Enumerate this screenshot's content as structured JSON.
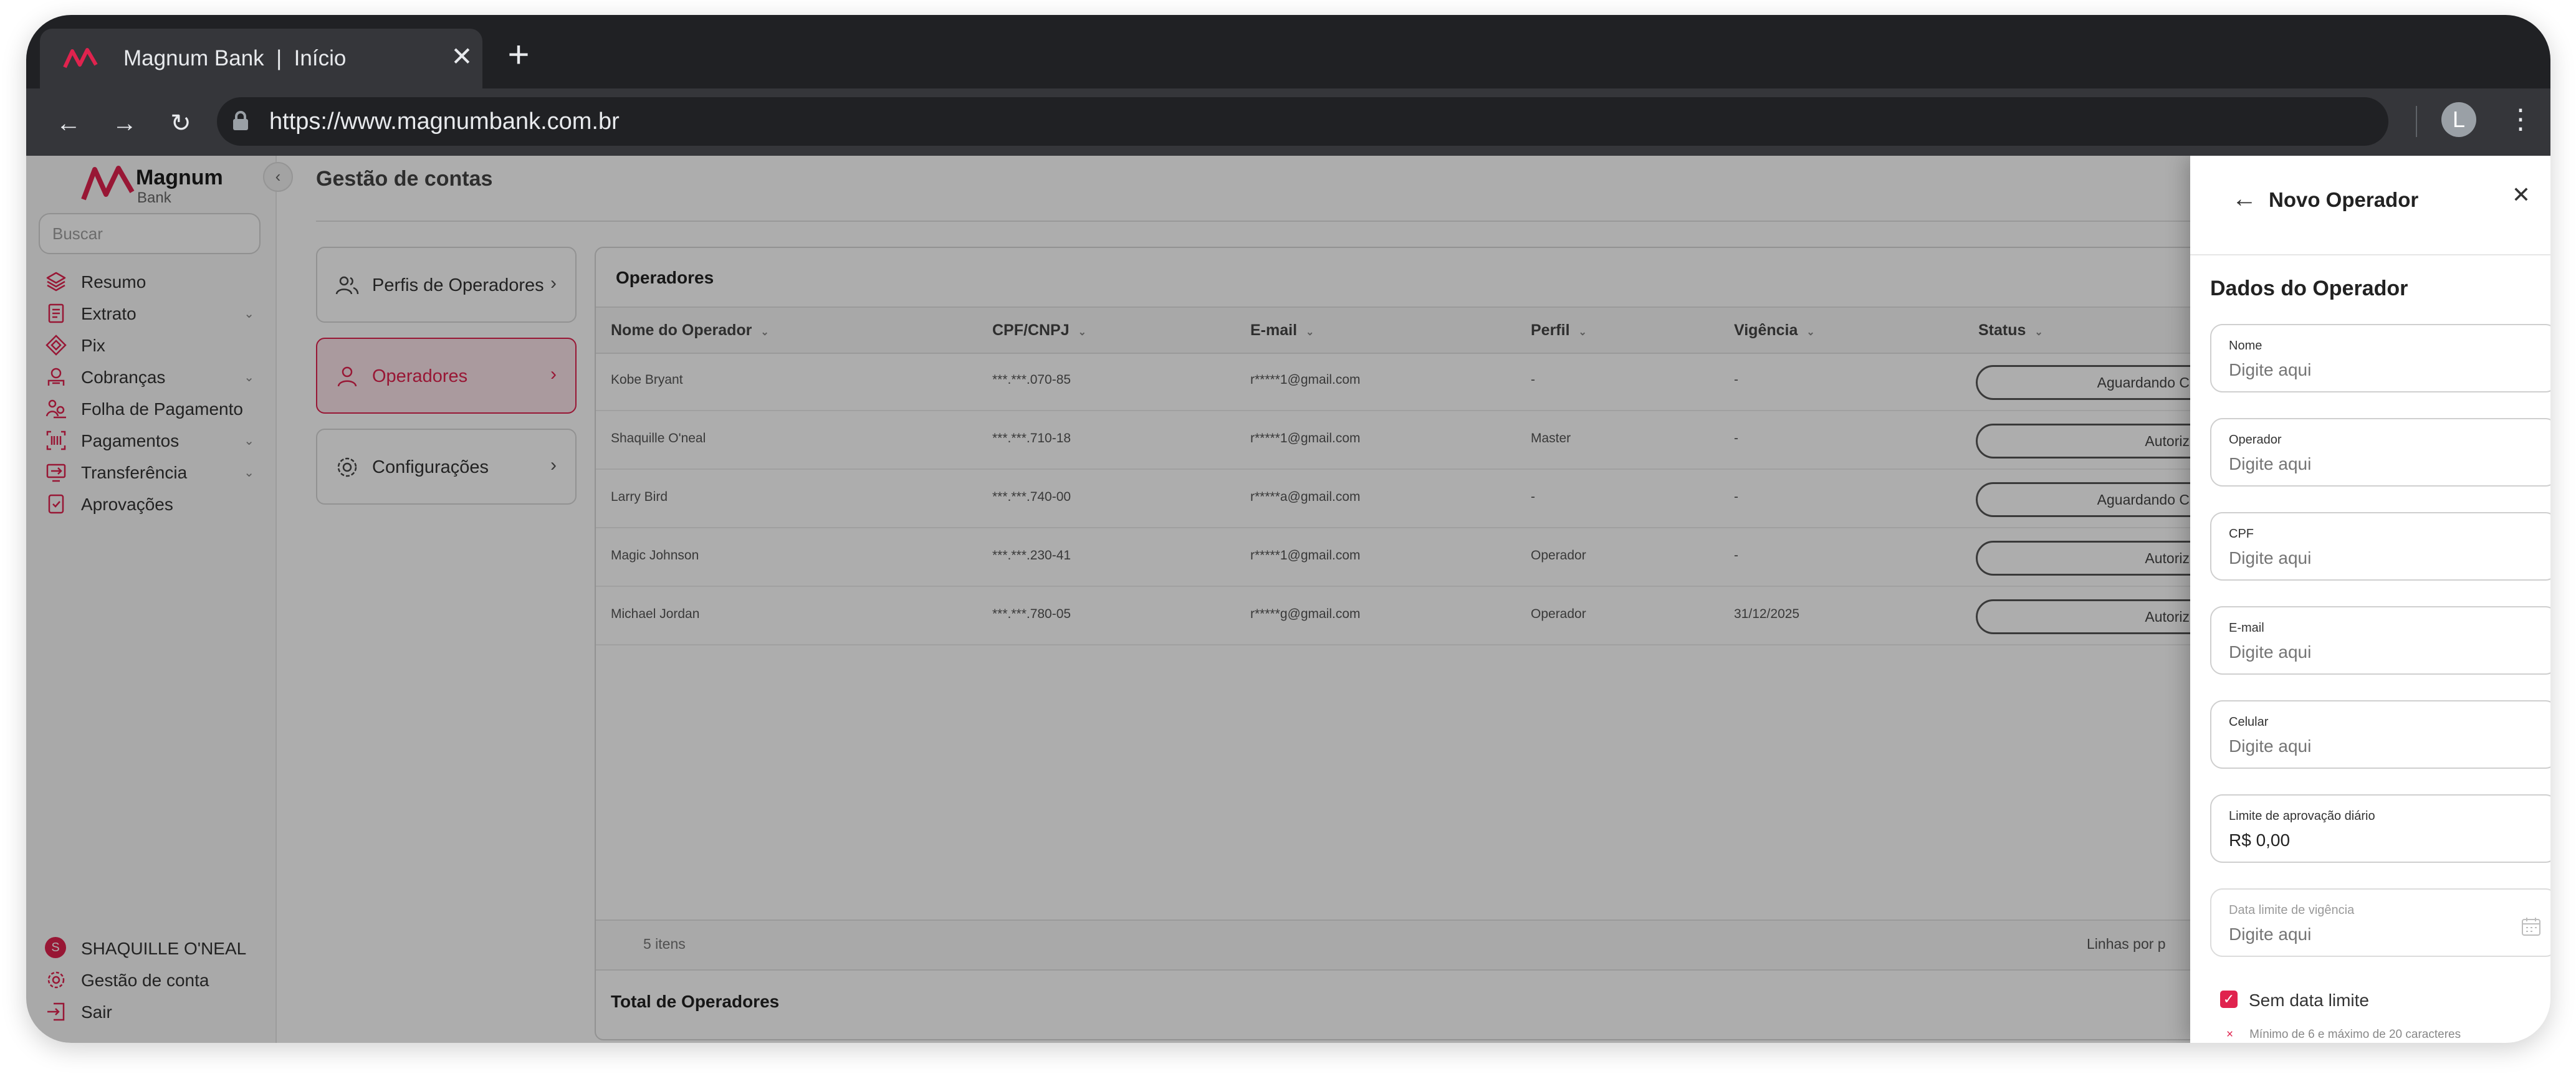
{
  "browser": {
    "tab_title": "Magnum Bank  |  Início",
    "url": "https://www.magnumbank.com.br",
    "profile_initial": "L"
  },
  "brand": {
    "name": "Magnum",
    "sub": "Bank",
    "color": "#e0234e"
  },
  "sidebar": {
    "search_placeholder": "Buscar",
    "items": [
      {
        "label": "Resumo",
        "icon": "layers-icon",
        "has_submenu": false
      },
      {
        "label": "Extrato",
        "icon": "statement-icon",
        "has_submenu": true
      },
      {
        "label": "Pix",
        "icon": "pix-icon",
        "has_submenu": false
      },
      {
        "label": "Cobranças",
        "icon": "billing-icon",
        "has_submenu": true
      },
      {
        "label": "Folha de Pagamento",
        "icon": "payroll-icon",
        "has_submenu": false
      },
      {
        "label": "Pagamentos",
        "icon": "barcode-icon",
        "has_submenu": true
      },
      {
        "label": "Transferência",
        "icon": "transfer-icon",
        "has_submenu": true
      },
      {
        "label": "Aprovações",
        "icon": "approval-icon",
        "has_submenu": false
      }
    ],
    "footer": {
      "user_initial": "S",
      "user_name": "SHAQUILLE O'NEAL",
      "account": "Gestão de conta",
      "logout": "Sair"
    }
  },
  "main": {
    "title": "Gestão de contas",
    "nav_cards": [
      {
        "label": "Perfis de Operadores",
        "icon": "users-icon",
        "active": false
      },
      {
        "label": "Operadores",
        "icon": "user-icon",
        "active": true
      },
      {
        "label": "Configurações",
        "icon": "gear-icon",
        "active": false
      }
    ]
  },
  "table": {
    "title": "Operadores",
    "columns": [
      "Nome do Operador",
      "CPF/CNPJ",
      "E-mail",
      "Perfil",
      "Vigência",
      "Status"
    ],
    "rows": [
      {
        "name": "Kobe Bryant",
        "doc": "***.***.070-85",
        "email": "r*****1@gmail.com",
        "profile": "-",
        "validity": "-",
        "status": "Aguardando C"
      },
      {
        "name": "Shaquille O'neal",
        "doc": "***.***.710-18",
        "email": "r*****1@gmail.com",
        "profile": "Master",
        "validity": "-",
        "status": "Autoriz"
      },
      {
        "name": "Larry Bird",
        "doc": "***.***.740-00",
        "email": "r*****a@gmail.com",
        "profile": "-",
        "validity": "-",
        "status": "Aguardando C"
      },
      {
        "name": "Magic Johnson",
        "doc": "***.***.230-41",
        "email": "r*****1@gmail.com",
        "profile": "Operador",
        "validity": "-",
        "status": "Autoriz"
      },
      {
        "name": "Michael Jordan",
        "doc": "***.***.780-05",
        "email": "r*****g@gmail.com",
        "profile": "Operador",
        "validity": "31/12/2025",
        "status": "Autoriz"
      }
    ],
    "footer_count": "5 itens",
    "footer_per_page": "Linhas por p",
    "total_label": "Total de Operadores"
  },
  "drawer": {
    "title": "Novo Operador",
    "section_title": "Dados do Operador",
    "fields": [
      {
        "label": "Nome",
        "value": "",
        "placeholder": "Digite aqui"
      },
      {
        "label": "Operador",
        "value": "",
        "placeholder": "Digite aqui"
      },
      {
        "label": "CPF",
        "value": "",
        "placeholder": "Digite aqui"
      },
      {
        "label": "E-mail",
        "value": "",
        "placeholder": "Digite aqui"
      },
      {
        "label": "Celular",
        "value": "",
        "placeholder": "Digite aqui"
      },
      {
        "label": "Limite de aprovação diário",
        "value": "R$ 0,00",
        "placeholder": ""
      },
      {
        "label": "Data limite de vigência",
        "value": "",
        "placeholder": "Digite aqui"
      }
    ],
    "checkbox_label": "Sem data limite",
    "checkbox_checked": true,
    "hint": "Mínimo de 6 e máximo de 20 caracteres",
    "hint_mark": "×"
  }
}
